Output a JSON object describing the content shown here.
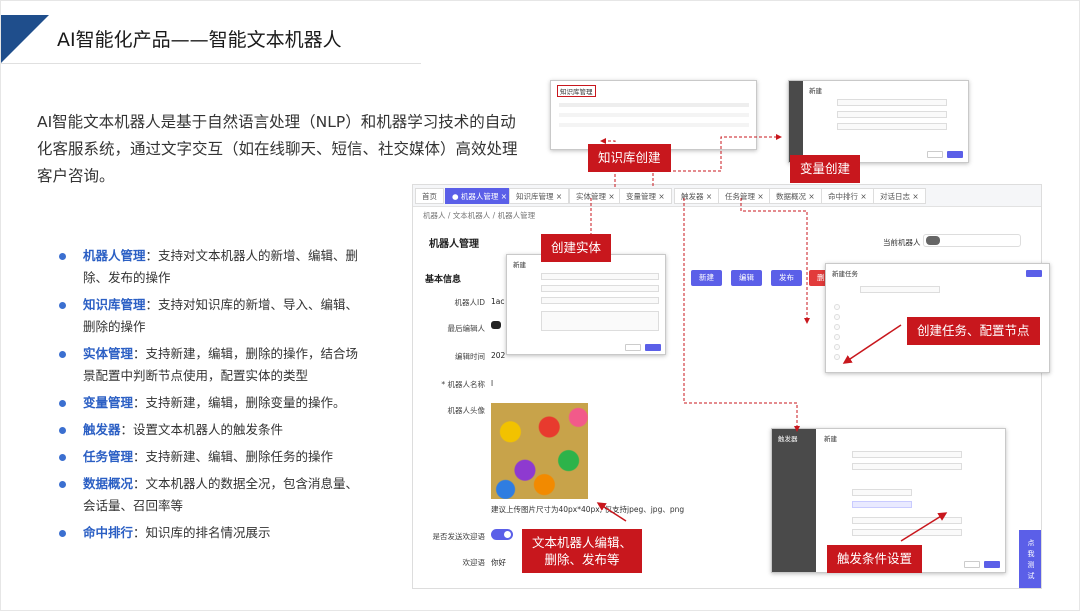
{
  "slide": {
    "title": "AI智能化产品——智能文本机器人",
    "intro": "AI智能文本机器人是基于自然语言处理（NLP）和机器学习技术的自动化客服系统，通过文字交互（如在线聊天、短信、社交媒体）高效处理客户咨询。",
    "features": [
      {
        "name": "机器人管理",
        "desc": "：支持对文本机器人的新增、编辑、删除、发布的操作"
      },
      {
        "name": "知识库管理",
        "desc": "：支持对知识库的新增、导入、编辑、删除的操作"
      },
      {
        "name": "实体管理",
        "desc": "：支持新建，编辑，删除的操作，结合场景配置中判断节点使用，配置实体的类型"
      },
      {
        "name": "变量管理",
        "desc": "：支持新建，编辑，删除变量的操作。"
      },
      {
        "name": "触发器",
        "desc": "：设置文本机器人的触发条件"
      },
      {
        "name": "任务管理",
        "desc": "：支持新建、编辑、删除任务的操作"
      },
      {
        "name": "数据概况",
        "desc": "：文本机器人的数据全况，包含消息量、会话量、召回率等"
      },
      {
        "name": "命中排行",
        "desc": "：知识库的排名情况展示"
      }
    ]
  },
  "callouts": {
    "kb_create": "知识库创建",
    "var_create": "变量创建",
    "entity_create": "创建实体",
    "task_create": "创建任务、配置节点",
    "robot_edit": "文本机器人编辑、\n删除、发布等",
    "trigger_setup": "触发条件设置"
  },
  "app": {
    "tabs": [
      {
        "label": "首页",
        "active": false
      },
      {
        "label": "● 机器人管理 ×",
        "active": true
      },
      {
        "label": "知识库管理 ×",
        "active": false
      },
      {
        "label": "实体管理 ×",
        "active": false
      },
      {
        "label": "变量管理 ×",
        "active": false
      },
      {
        "label": "触发器 ×",
        "active": false
      },
      {
        "label": "任务管理 ×",
        "active": false
      },
      {
        "label": "数据概况 ×",
        "active": false
      },
      {
        "label": "命中排行 ×",
        "active": false
      },
      {
        "label": "对话日志 ×",
        "active": false
      }
    ],
    "breadcrumb": "机器人  /  文本机器人  /  机器人管理",
    "page_title": "机器人管理",
    "current_robot_label": "当前机器人",
    "section_title": "基本信息",
    "buttons": {
      "new": "新建",
      "edit": "编辑",
      "publish": "发布",
      "delete": "删"
    },
    "fields": {
      "robot_id_label": "机器人ID",
      "robot_id_value": "1ac",
      "last_editor_label": "最后编辑人",
      "edit_time_label": "编辑时间",
      "edit_time_value": "202",
      "robot_name_label": "* 机器人名称",
      "robot_name_value": "l",
      "avatar_label": "机器人头像",
      "avatar_hint": "建议上传图片尺寸为40px*40px, 仅支持jpeg、jpg、png",
      "send_welcome_label": "是否发送欢迎语",
      "welcome_label": "欢迎语",
      "welcome_value": "你好"
    },
    "test_button": "点\n我\n测\n试"
  },
  "thumbs": {
    "entity_dialog_title": "新建",
    "var_dialog_title": "新建",
    "trigger_dialog_title": "新建",
    "trigger_side_label": "触发器",
    "kb_title": "知识库管理",
    "task_title": "新建任务"
  },
  "colors": {
    "brand_blue": "#1f4e8c",
    "primary": "#5b5fe8",
    "callout_red": "#c8171d"
  }
}
